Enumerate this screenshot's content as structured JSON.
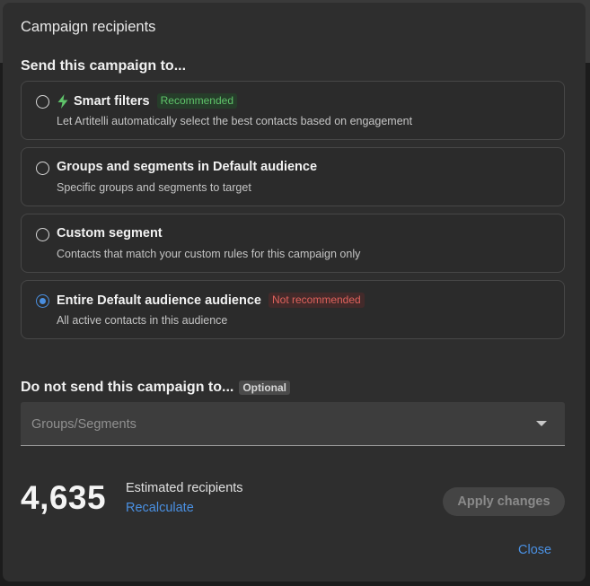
{
  "dialog": {
    "title": "Campaign recipients"
  },
  "send_section": {
    "heading": "Send this campaign to...",
    "options": [
      {
        "title_prefix": "Smart filters",
        "title_bold": "",
        "title_suffix": "",
        "badge": "Recommended",
        "badge_color": "#5fc46a",
        "description": "Let Artitelli automatically select the best contacts based on engagement",
        "icon": "lightning-bolt-icon",
        "checked": false
      },
      {
        "title_prefix": "Groups and segments in",
        "title_bold": "Default audience",
        "title_suffix": "",
        "badge": "",
        "description": "Specific groups and segments to target",
        "checked": false
      },
      {
        "title_prefix": "Custom segment",
        "title_bold": "",
        "title_suffix": "",
        "badge": "",
        "description": "Contacts that match your custom rules for this campaign only",
        "checked": false
      },
      {
        "title_prefix": "Entire",
        "title_bold": "Default audience",
        "title_suffix": "audience",
        "badge": "Not recommended",
        "badge_color": "#e0625c",
        "description": "All active contacts in this audience",
        "checked": true
      }
    ]
  },
  "exclude_section": {
    "heading": "Do not send this campaign to...",
    "badge": "Optional",
    "select_placeholder": "Groups/Segments"
  },
  "summary": {
    "count": "4,635",
    "label": "Estimated recipients",
    "recalculate": "Recalculate"
  },
  "actions": {
    "apply": "Apply changes",
    "close": "Close"
  },
  "colors": {
    "accent": "#4a90e2",
    "recommended": "#5fc46a",
    "not_recommended": "#e0625c"
  }
}
